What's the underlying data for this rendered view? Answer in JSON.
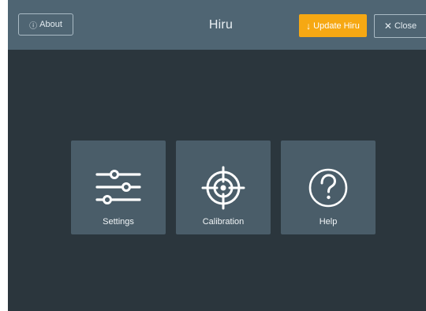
{
  "header": {
    "about_label": "About",
    "about_icon": "info-circle-icon",
    "title": "Hiru",
    "update_label": "Update Hiru",
    "update_icon": "download-arrow-icon",
    "close_label": "Close",
    "close_icon": "close-icon"
  },
  "tiles": [
    {
      "label": "Settings",
      "icon": "sliders-icon"
    },
    {
      "label": "Calibration",
      "icon": "crosshair-icon"
    },
    {
      "label": "Help",
      "icon": "question-circle-icon"
    }
  ],
  "colors": {
    "background": "#2b363d",
    "topbar": "#4f6573",
    "tile": "#4a5d69",
    "accent": "#f6a813"
  }
}
